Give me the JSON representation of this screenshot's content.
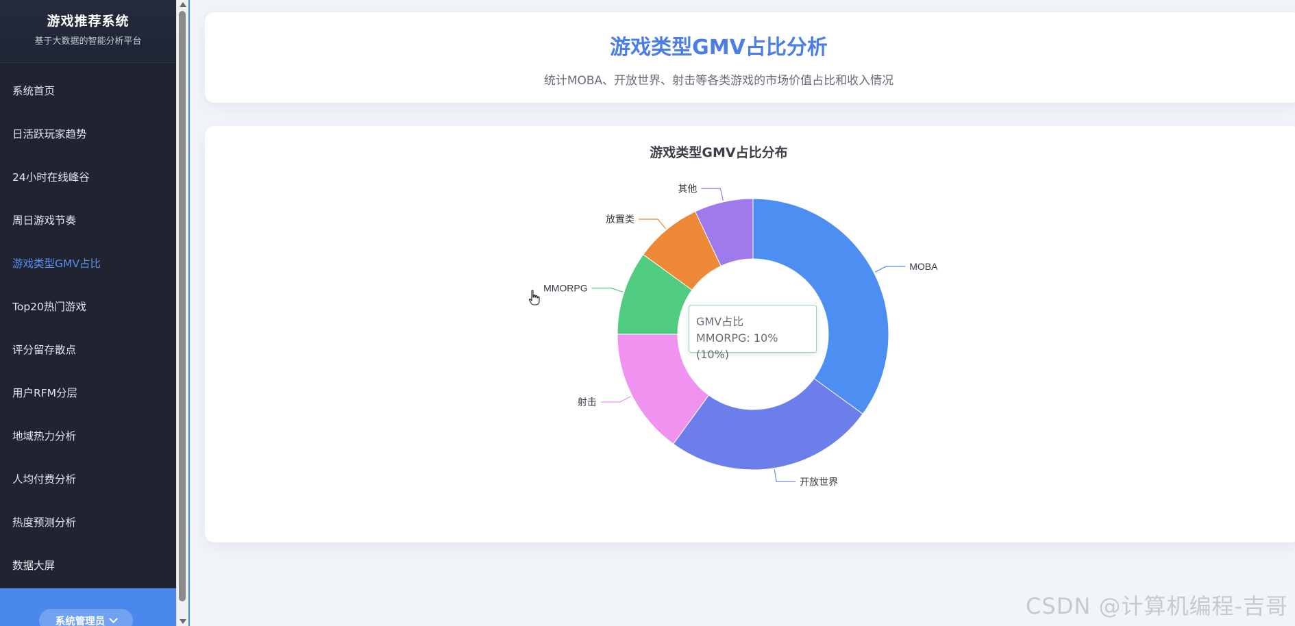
{
  "sidebar": {
    "brand_title": "游戏推荐系统",
    "brand_subtitle": "基于大数据的智能分析平台",
    "items": [
      {
        "label": "系统首页",
        "active": false
      },
      {
        "label": "日活跃玩家趋势",
        "active": false
      },
      {
        "label": "24小时在线峰谷",
        "active": false
      },
      {
        "label": "周日游戏节奏",
        "active": false
      },
      {
        "label": "游戏类型GMV占比",
        "active": true
      },
      {
        "label": "Top20热门游戏",
        "active": false
      },
      {
        "label": "评分留存散点",
        "active": false
      },
      {
        "label": "用户RFM分层",
        "active": false
      },
      {
        "label": "地域热力分析",
        "active": false
      },
      {
        "label": "人均付费分析",
        "active": false
      },
      {
        "label": "热度预测分析",
        "active": false
      },
      {
        "label": "数据大屏",
        "active": false
      }
    ],
    "user_label": "系统管理员"
  },
  "header": {
    "title": "游戏类型GMV占比分析",
    "subtitle": "统计MOBA、开放世界、射击等各类游戏的市场价值占比和收入情况"
  },
  "tooltip": {
    "title": "GMV占比",
    "value": "MMORPG: 10% (10%)"
  },
  "watermark": "CSDN @计算机编程-吉哥",
  "chart_data": {
    "type": "pie",
    "donut": true,
    "title": "游戏类型GMV占比分布",
    "series": [
      {
        "name": "MOBA",
        "value": 35,
        "color": "#4d8ef3"
      },
      {
        "name": "开放世界",
        "value": 25,
        "color": "#6c7ee9"
      },
      {
        "name": "射击",
        "value": 15,
        "color": "#ef92f0"
      },
      {
        "name": "MMORPG",
        "value": 10,
        "color": "#4fcc7f"
      },
      {
        "name": "放置类",
        "value": 8,
        "color": "#ed8936"
      },
      {
        "name": "其他",
        "value": 7,
        "color": "#9f7aea"
      }
    ]
  }
}
